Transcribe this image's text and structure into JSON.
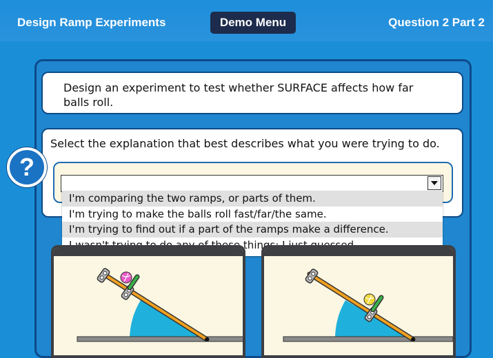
{
  "header": {
    "title": "Design Ramp Experiments",
    "menu_button": "Demo Menu",
    "question_label": "Question 2 Part 2"
  },
  "prompt": {
    "line1": "Design an experiment to test whether SURFACE affects how far",
    "line2": "balls roll."
  },
  "question": {
    "text": "Select the explanation that best describes what you were trying to do.",
    "help_symbol": "?",
    "selected_value": "",
    "options": [
      "I'm comparing the two ramps, or parts of them.",
      "I'm trying to make the balls roll fast/far/the same.",
      "I'm trying to find out if a part of the ramps make a difference.",
      "I wasn't trying to do any of these things; I just guessed."
    ]
  },
  "colors": {
    "background": "#1a8fd8",
    "header": "#1e8edb",
    "menu_button": "#1d2c4d",
    "ramp": "#f0a020",
    "angle_fill": "#1fb1db",
    "ball_left": "#e85ac8",
    "ball_right": "#f2d83a",
    "gate": "#3ab24a"
  }
}
